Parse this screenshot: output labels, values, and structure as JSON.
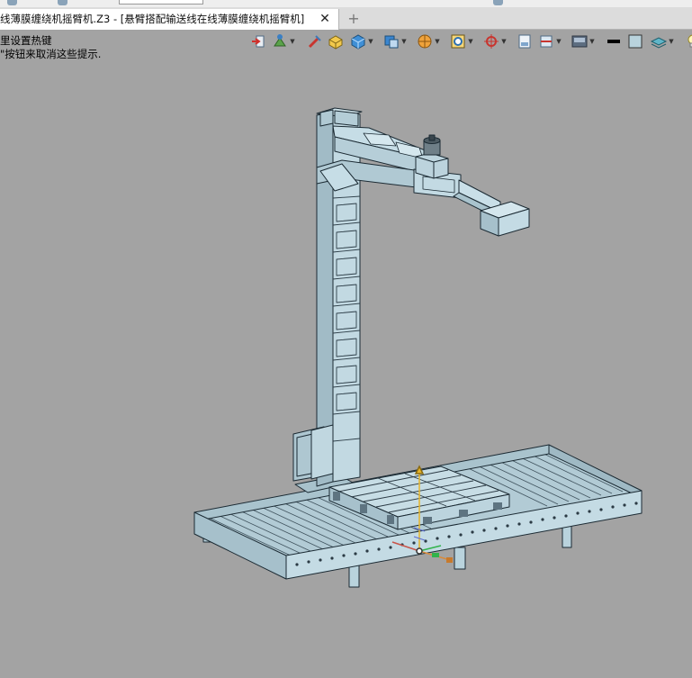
{
  "window": {
    "tab_title": "线薄膜缠绕机摇臂机.Z3 - [悬臂搭配输送线在线薄膜缠绕机摇臂机]",
    "tab_close_glyph": "✕",
    "new_tab_glyph": "+"
  },
  "hint": {
    "line1": "里设置热键",
    "line2": "\"按钮来取消这些提示."
  },
  "toolbar": {
    "icons": [
      "exit-sketch-icon",
      "color-fill-icon",
      "pen-icon",
      "box-select-icon",
      "shaded-cube-icon",
      "view-cube-icon",
      "render-sphere-icon",
      "zoom-fit-icon",
      "axis-origin-icon",
      "sheet-icon",
      "section-icon",
      "display-mode-icon",
      "line-color-icon",
      "face-color-icon",
      "layer-icon"
    ]
  },
  "viewport": {
    "background": "#a3a3a3",
    "model_fill": "#b9d3dd",
    "model_edge": "#1b2a33"
  }
}
